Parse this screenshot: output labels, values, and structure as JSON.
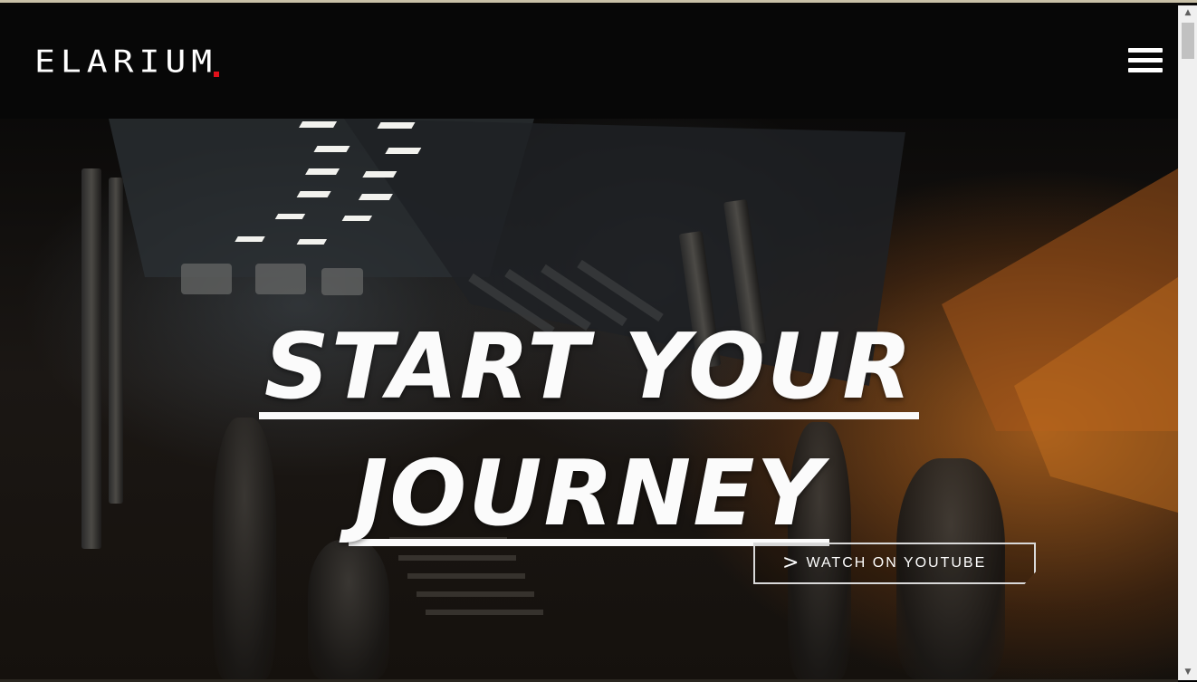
{
  "logo": {
    "text": "ELARIUM",
    "accent_color": "#e0101a"
  },
  "header": {
    "menu_icon": "hamburger-menu-icon"
  },
  "hero": {
    "headline_line1": "START YOUR",
    "headline_line2": "JOURNEY",
    "cta_label": "WATCH ON YOUTUBE",
    "cta_icon": "chevron-right-icon",
    "cta_chevron": ">"
  },
  "scrollbar": {
    "up_arrow": "▲",
    "down_arrow": "▼"
  },
  "colors": {
    "text": "#fbfbfb",
    "background": "#0a0908",
    "glow": "#b0621c"
  }
}
